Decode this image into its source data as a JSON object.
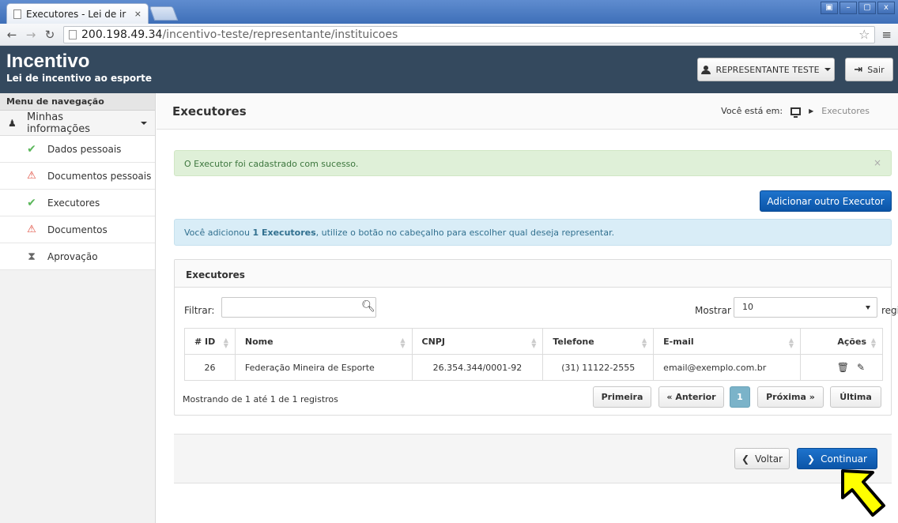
{
  "browser": {
    "tab_title": "Executores - Lei de ir",
    "tab_close": "×",
    "url_host": "200.198.49.34",
    "url_path": "/incentivo-teste/representante/instituicoes",
    "window_controls": [
      "▣",
      "–",
      "▢",
      "x"
    ]
  },
  "header": {
    "brand_title": "Incentivo",
    "brand_subtitle": "Lei de incentivo ao esporte",
    "user_label": "REPRESENTANTE TESTE",
    "logout_label": "Sair"
  },
  "sidebar": {
    "heading": "Menu de navegação",
    "group_label": "Minhas informações",
    "items": [
      {
        "label": "Dados pessoais",
        "status": "ok"
      },
      {
        "label": "Documentos pessoais",
        "status": "warn"
      },
      {
        "label": "Executores",
        "status": "ok"
      },
      {
        "label": "Documentos",
        "status": "warn"
      },
      {
        "label": "Aprovação",
        "status": "wait"
      }
    ]
  },
  "page": {
    "title": "Executores",
    "breadcrumb_prefix": "Você está em:",
    "breadcrumb_current": "Executores"
  },
  "alerts": {
    "success": "O Executor foi cadastrado com sucesso.",
    "close": "×",
    "info_pre": "Você adicionou ",
    "info_bold": "1 Executores",
    "info_post": ", utilize o botão no cabeçalho para escolher qual deseja representar."
  },
  "actions": {
    "add_label": "Adicionar outro Executor",
    "back_label": "Voltar",
    "continue_label": "Continuar"
  },
  "table": {
    "panel_title": "Executores",
    "filter_label": "Filtrar:",
    "filter_value": "",
    "show_label": "Mostrar",
    "show_value": "10",
    "records_label": "registros",
    "columns": [
      "# ID",
      "Nome",
      "CNPJ",
      "Telefone",
      "E-mail",
      "Ações"
    ],
    "rows": [
      {
        "id": "26",
        "nome": "Federação Mineira de Esporte",
        "cnpj": "26.354.344/0001-92",
        "telefone": "(31) 11122-2555",
        "email": "email@exemplo.com.br"
      }
    ],
    "info": "Mostrando de 1 até 1 de 1 registros",
    "pager": {
      "first": "Primeira",
      "prev": "« Anterior",
      "page": "1",
      "next": "Próxima »",
      "last": "Última"
    }
  },
  "colors": {
    "header_bg": "#34495e",
    "primary": "#0b55a8",
    "success_bg": "#dff0d8",
    "info_bg": "#d9edf7",
    "pointer": "#ffff00"
  }
}
